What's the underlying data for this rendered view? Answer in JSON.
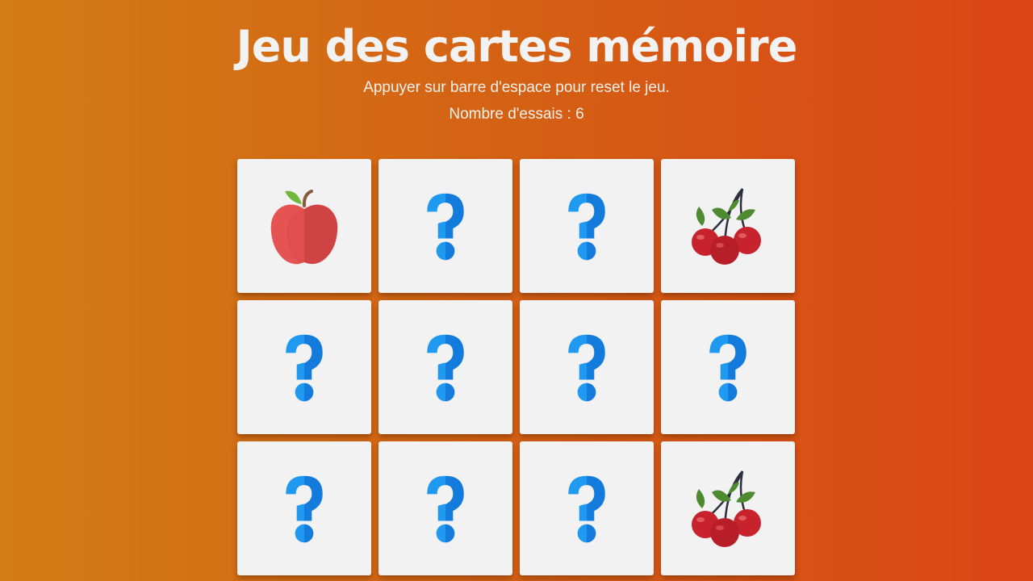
{
  "header": {
    "title": "Jeu des cartes mémoire",
    "instructions": "Appuyer sur barre d'espace pour reset le jeu.",
    "attempts_text": "Nombre d'essais : 6"
  },
  "board": {
    "cards": [
      {
        "state": "revealed",
        "icon": "apple-icon"
      },
      {
        "state": "hidden",
        "icon": "question-mark-icon"
      },
      {
        "state": "hidden",
        "icon": "question-mark-icon"
      },
      {
        "state": "revealed",
        "icon": "cherries-icon"
      },
      {
        "state": "hidden",
        "icon": "question-mark-icon"
      },
      {
        "state": "hidden",
        "icon": "question-mark-icon"
      },
      {
        "state": "hidden",
        "icon": "question-mark-icon"
      },
      {
        "state": "hidden",
        "icon": "question-mark-icon"
      },
      {
        "state": "hidden",
        "icon": "question-mark-icon"
      },
      {
        "state": "hidden",
        "icon": "question-mark-icon"
      },
      {
        "state": "hidden",
        "icon": "question-mark-icon"
      },
      {
        "state": "revealed",
        "icon": "cherries-icon"
      }
    ]
  },
  "colors": {
    "background_left": "#d27c16",
    "background_right": "#db4416",
    "card_face": "#f2f2f2",
    "question_light": "#1f9af0",
    "question_dark": "#137bdc",
    "apple_red": "#e04f4e",
    "cherry_red": "#c8232c"
  }
}
